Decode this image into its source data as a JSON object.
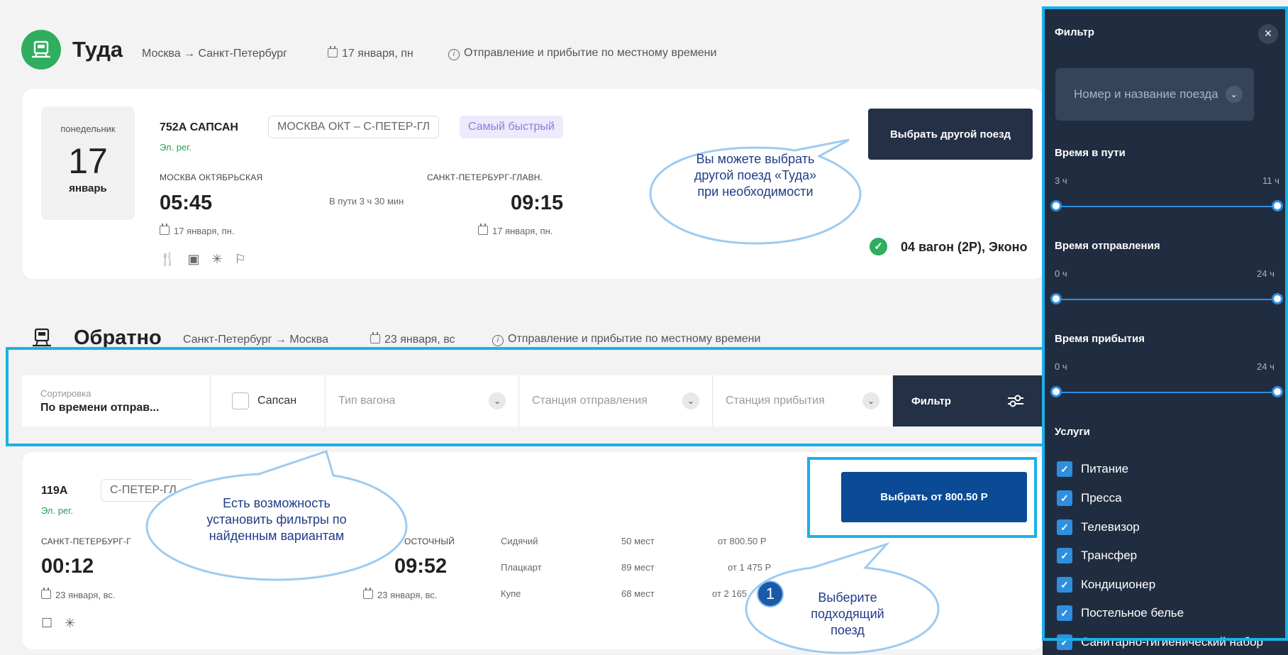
{
  "outbound": {
    "title": "Туда",
    "route": "Москва → Санкт-Петербург",
    "date": "17 января, пн",
    "time_note": "Отправление и прибытие по местному времени",
    "train": {
      "weekday": "понедельник",
      "day": "17",
      "month": "январь",
      "number": "752А САПСАН",
      "route": "МОСКВА ОКТ – С-ПЕТЕР-ГЛ",
      "tag": "Самый быстрый",
      "reg": "Эл. рег.",
      "from_station": "МОСКВА ОКТЯБРЬСКАЯ",
      "to_station": "САНКТ-ПЕТЕРБУРГ-ГЛАВН.",
      "dep_time": "05:45",
      "arr_time": "09:15",
      "duration": "В пути 3 ч 30 мин",
      "dep_date": "17 января, пн.",
      "arr_date": "17 января, пн."
    },
    "choose_other_label": "Выбрать другой поезд",
    "selected_car": "04 вагон (2Р), Эконо"
  },
  "return": {
    "title": "Обратно",
    "route": "Санкт-Петербург → Москва",
    "date": "23 января, вс",
    "time_note": "Отправление и прибытие по местному времени"
  },
  "filter_bar": {
    "sort_label": "Сортировка",
    "sort_value": "По времени отправ...",
    "sapsan_label": "Сапсан",
    "car_type_placeholder": "Тип вагона",
    "dep_station_placeholder": "Станция отправления",
    "arr_station_placeholder": "Станция прибытия",
    "filter_label": "Фильтр"
  },
  "return_train": {
    "number": "119А",
    "route": "С-ПЕТЕР-ГЛ – ",
    "reg": "Эл. рег.",
    "from_station": "САНКТ-ПЕТЕРБУРГ-Г",
    "to_station": "ОСТОЧНЫЙ",
    "dep_time": "00:12",
    "arr_time": "09:52",
    "dep_date": "23 января, вс.",
    "arr_date": "23 января, вс.",
    "classes": [
      {
        "name": "Сидячий",
        "seats": "50 мест",
        "price": "от 800.50 Р"
      },
      {
        "name": "Плацкарт",
        "seats": "89 мест",
        "price": "от 1 475 Р"
      },
      {
        "name": "Купе",
        "seats": "68 мест",
        "price": "от 2 165"
      }
    ],
    "select_label": "Выбрать от 800.50 Р"
  },
  "callouts": {
    "choose_other": "Вы можете выбрать другой поезд «Туда» при необходимости",
    "filters": "Есть возможность установить фильтры по найденным вариантам",
    "choose_train": "Выберите подходящий поезд",
    "step_number": "1"
  },
  "panel": {
    "title": "Фильтр",
    "close": "×",
    "train_select": "Номер и название поезда",
    "travel_time": {
      "label": "Время в пути",
      "min": "3 ч",
      "max": "11 ч"
    },
    "departure_time": {
      "label": "Время отправления",
      "min": "0 ч",
      "max": "24 ч"
    },
    "arrival_time": {
      "label": "Время прибытия",
      "min": "0 ч",
      "max": "24 ч"
    },
    "services_label": "Услуги",
    "services": [
      "Питание",
      "Пресса",
      "Телевизор",
      "Трансфер",
      "Кондиционер",
      "Постельное белье",
      "Санитарно-гигиенический набор"
    ]
  },
  "colors": {
    "accent_green": "#2eae5e",
    "dark_button": "#233045",
    "blue_button": "#0b4a94",
    "highlight": "#1ab0ea",
    "panel_bg": "#202d40"
  }
}
